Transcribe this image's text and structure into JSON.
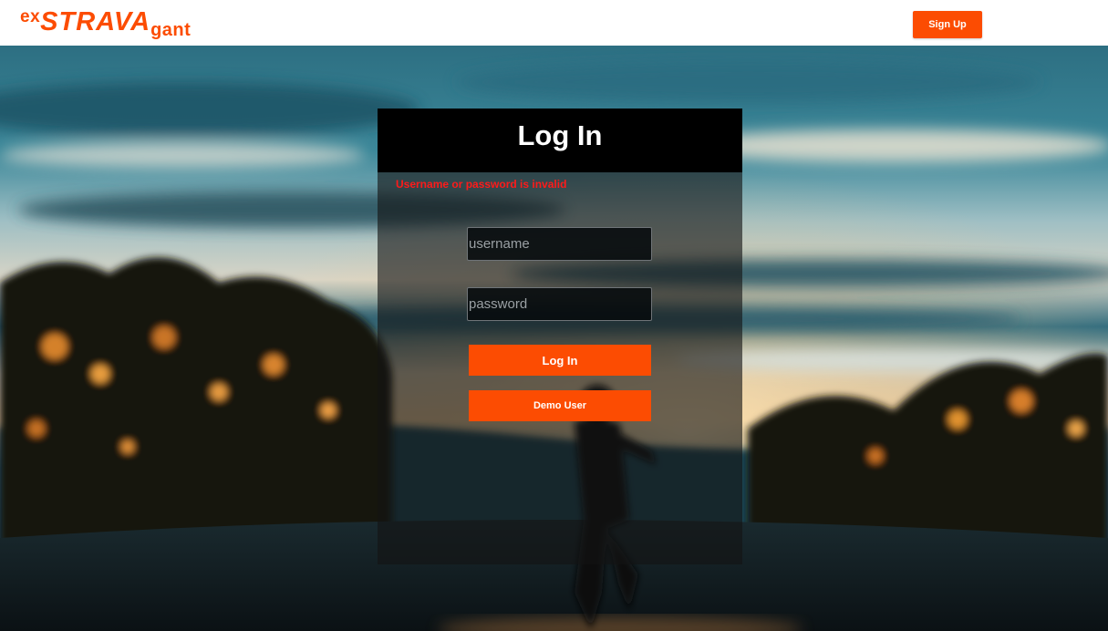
{
  "header": {
    "logo": {
      "prefix": "ex",
      "main": "STRAVA",
      "suffix": "gant"
    },
    "signup_label": "Sign Up"
  },
  "login": {
    "title": "Log In",
    "error": "Username or password is invalid",
    "username_placeholder": "username",
    "password_placeholder": "password",
    "submit_label": "Log In",
    "demo_label": "Demo User"
  },
  "colors": {
    "brand": "#fc4c02",
    "error": "#ff1a1a",
    "panel_header": "#000000"
  },
  "background": {
    "description_icon": "sunset-runner-photo"
  }
}
